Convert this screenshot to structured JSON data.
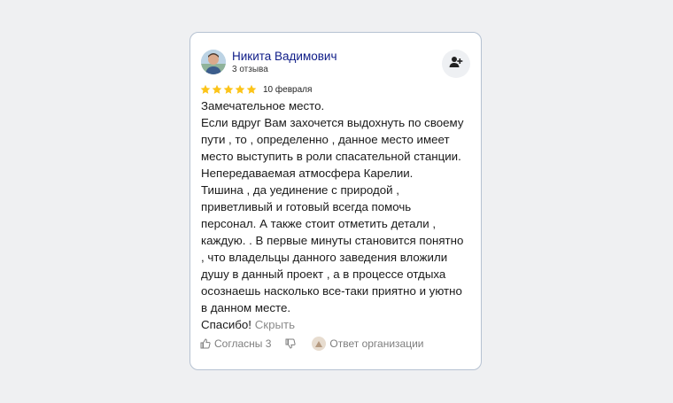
{
  "author": {
    "name": "Никита Вадимович",
    "reviews_count": "3 отзыва"
  },
  "rating": 5,
  "star_color": "#fcc419",
  "date": "10 февраля",
  "review_lines": [
    "Замечательное место.",
    "Если вдруг Вам захочется выдохнуть по своему",
    "пути , то , определенно , данное место имеет",
    "место выступить в роли спасательной станции.",
    "Непередаваемая атмосфера Карелии.",
    "Тишина , да уединение с природой ,",
    "приветливый и готовый всегда помочь",
    "персонал. А также стоит отметить детали ,",
    "каждую. . В первые минуты становится понятно",
    ", что владельцы данного заведения вложили",
    "душу в данный проект , а в процессе отдыха",
    "осознаешь насколько все-таки приятно и уютно",
    "в данном месте."
  ],
  "review_last": "Спасибо!",
  "hide_label": "Скрыть",
  "actions": {
    "agree_label": "Согласны 3",
    "org_reply_label": "Ответ организации"
  },
  "icons": {
    "subscribe": "person-add-icon",
    "like": "thumb-up-icon",
    "dislike": "thumb-down-icon",
    "star": "star-icon"
  }
}
